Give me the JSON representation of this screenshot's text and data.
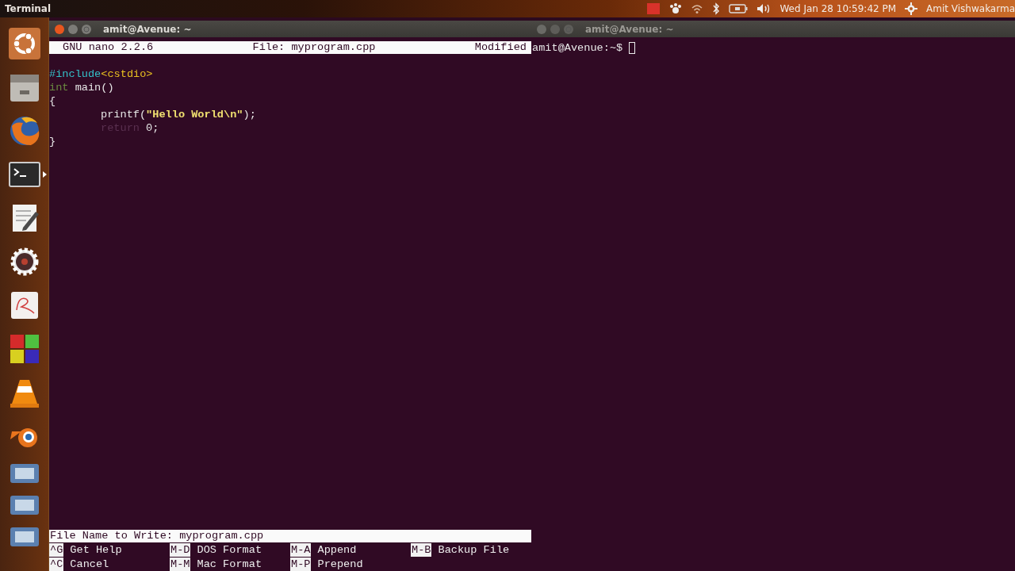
{
  "top_panel": {
    "title": "Terminal",
    "clock": "Wed Jan 28 10:59:42 PM",
    "user": "Amit Vishwakarma"
  },
  "launcher": {
    "items": [
      {
        "kind": "ubuntu",
        "active": false
      },
      {
        "kind": "files",
        "active": false
      },
      {
        "kind": "browser",
        "active": false
      },
      {
        "kind": "terminal",
        "active": true
      },
      {
        "kind": "editor",
        "active": false
      },
      {
        "kind": "gear",
        "active": false
      },
      {
        "kind": "document",
        "active": false
      },
      {
        "kind": "tiles",
        "active": false
      },
      {
        "kind": "cone",
        "active": false
      },
      {
        "kind": "blender",
        "active": false
      },
      {
        "kind": "folded",
        "active": false
      },
      {
        "kind": "folded",
        "active": false
      },
      {
        "kind": "folded",
        "active": false
      }
    ]
  },
  "windows": [
    {
      "kind": "nano",
      "title": "amit@Avenue: ~",
      "focused": true,
      "header": {
        "version": "GNU nano 2.2.6",
        "file": "File: myprogram.cpp",
        "state": "Modified"
      },
      "code_lines": [
        {
          "indented": false,
          "tokens": [
            {
              "kind": "preprocessor",
              "text": "#include"
            },
            {
              "kind": "header",
              "text": "<cstdio>"
            }
          ]
        },
        {
          "indented": false,
          "tokens": [
            {
              "kind": "type",
              "text": "int"
            },
            {
              "kind": "plain",
              "text": " main()"
            }
          ]
        },
        {
          "indented": false,
          "tokens": [
            {
              "kind": "plain",
              "text": "{"
            }
          ]
        },
        {
          "indented": true,
          "tokens": [
            {
              "kind": "plain",
              "text": "printf("
            },
            {
              "kind": "string",
              "text": "\"Hello World\\n\""
            },
            {
              "kind": "plain",
              "text": ");"
            }
          ]
        },
        {
          "indented": true,
          "tokens": [
            {
              "kind": "keyword",
              "text": "return"
            },
            {
              "kind": "plain",
              "text": " 0;"
            }
          ]
        },
        {
          "indented": false,
          "tokens": [
            {
              "kind": "plain",
              "text": "}"
            }
          ]
        }
      ],
      "prompt": "File Name to Write: myprogram.cpp",
      "shortcuts": [
        [
          {
            "key": "^G",
            "label": "Get Help"
          },
          {
            "key": "M-D",
            "label": "DOS Format"
          },
          {
            "key": "M-A",
            "label": "Append"
          },
          {
            "key": "M-B",
            "label": "Backup File"
          }
        ],
        [
          {
            "key": "^C",
            "label": "Cancel"
          },
          {
            "key": "M-M",
            "label": "Mac Format"
          },
          {
            "key": "M-P",
            "label": "Prepend"
          }
        ]
      ]
    },
    {
      "kind": "shell",
      "title": "amit@Avenue: ~",
      "focused": false,
      "prompt": "amit@Avenue:~$"
    }
  ]
}
